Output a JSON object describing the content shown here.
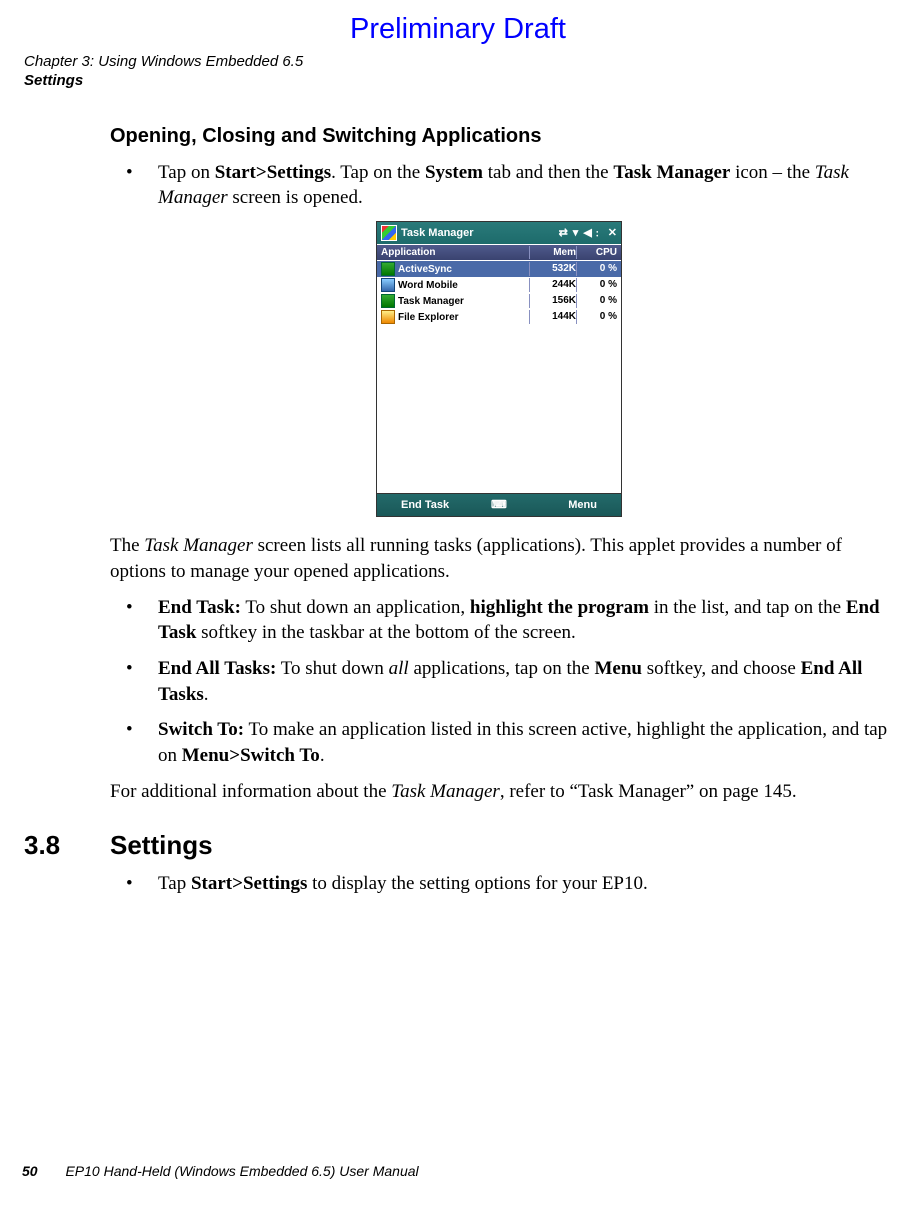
{
  "watermark": "Preliminary Draft",
  "chapter": {
    "line1": "Chapter 3:  Using Windows Embedded 6.5",
    "line2": "Settings"
  },
  "h3": "Opening, Closing and Switching Applications",
  "bullet_open": {
    "pre": "Tap on ",
    "b1": "Start>Settings",
    "mid1": ". Tap on the ",
    "b2": "System",
    "mid2": " tab and then the ",
    "b3": "Task Manager",
    "mid3": " icon – the ",
    "i4": "Task Manager",
    "post": " screen is opened."
  },
  "figure": {
    "title": "Task Manager",
    "columns": {
      "app": "Application",
      "mem": "Mem",
      "cpu": "CPU"
    },
    "rows": [
      {
        "name": "ActiveSync",
        "mem": "532K",
        "cpu": "0 %",
        "sel": true,
        "icon": "green"
      },
      {
        "name": "Word Mobile",
        "mem": "244K",
        "cpu": "0 %",
        "sel": false,
        "icon": "blue"
      },
      {
        "name": "Task Manager",
        "mem": "156K",
        "cpu": "0 %",
        "sel": false,
        "icon": "green"
      },
      {
        "name": "File Explorer",
        "mem": "144K",
        "cpu": "0 %",
        "sel": false,
        "icon": "orange"
      }
    ],
    "softkeys": {
      "left": "End Task",
      "right": "Menu"
    }
  },
  "para_after_fig": {
    "pre": "The ",
    "i1": "Task Manager",
    "post": " screen lists all running tasks (applications). This applet provides a number of options to manage your opened applications."
  },
  "bullets2": {
    "endtask": {
      "b1": "End Task:",
      "t1": " To shut down an application, ",
      "b2": "highlight the program",
      "t2": " in the list, and tap on the ",
      "b3": "End Task",
      "t3": " softkey in the taskbar at the bottom of the screen."
    },
    "endall": {
      "b1": "End All Tasks:",
      "t1": " To shut down ",
      "i1": "all",
      "t2": " applications, tap on the ",
      "b2": "Menu",
      "t3": " softkey, and choose ",
      "b3": "End All Tasks",
      "t4": "."
    },
    "switchto": {
      "b1": "Switch To:",
      "t1": " To make an application listed in this screen active, highlight the application, and tap on ",
      "b2": "Menu>Switch To",
      "t2": "."
    }
  },
  "para_ref": {
    "pre": "For additional information about the ",
    "i1": "Task Manager",
    "post": ", refer to “Task Manager” on page 145."
  },
  "section": {
    "num": "3.8",
    "title": "Settings"
  },
  "bullet_settings": {
    "pre": "Tap ",
    "b1": "Start>Settings",
    "post": " to display the setting options for your EP10."
  },
  "footer": {
    "page": "50",
    "manual": "EP10 Hand-Held (Windows Embedded 6.5) User Manual"
  }
}
